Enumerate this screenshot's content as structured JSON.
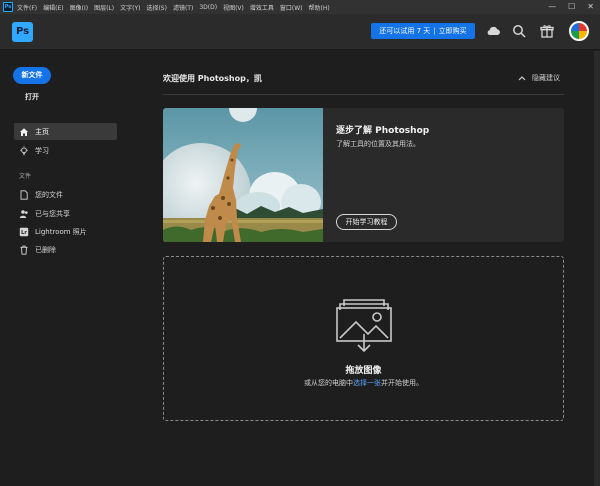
{
  "menubar": {
    "app_badge": "Ps",
    "items": [
      "文件(F)",
      "编辑(E)",
      "图像(I)",
      "图层(L)",
      "文字(Y)",
      "选择(S)",
      "滤镜(T)",
      "3D(D)",
      "视图(V)",
      "增效工具",
      "窗口(W)",
      "帮助(H)"
    ],
    "window_controls": {
      "minimize": "—",
      "maximize": "☐",
      "close": "✕"
    }
  },
  "toolbar": {
    "logo_text": "Ps",
    "trial_text": "还可以试用 7 天",
    "buy_text": "立即购买",
    "icons": [
      "cloud-icon",
      "search-icon",
      "gift-icon",
      "avatar"
    ]
  },
  "sidebar": {
    "new_file_label": "新文件",
    "open_label": "打开",
    "nav": [
      {
        "label": "主页",
        "icon": "home-icon",
        "active": true
      },
      {
        "label": "学习",
        "icon": "lightbulb-icon",
        "active": false
      }
    ],
    "files_section_label": "文件",
    "file_nav": [
      {
        "label": "您的文件",
        "icon": "document-icon"
      },
      {
        "label": "已与您共享",
        "icon": "shared-users-icon"
      },
      {
        "label": "Lightroom 照片",
        "icon": "lightroom-icon"
      },
      {
        "label": "已删除",
        "icon": "trash-icon"
      }
    ]
  },
  "main": {
    "welcome": "欢迎使用 Photoshop，凯",
    "hide_tips_label": "隐藏建议",
    "card": {
      "title": "逐步了解 Photoshop",
      "description": "了解工具的位置及其用法。",
      "button_label": "开始学习教程"
    },
    "dropzone": {
      "title": "拖放图像",
      "sub_before": "或从您的电脑中",
      "sub_link": "选择一张",
      "sub_after": "并开始使用。"
    }
  },
  "colors": {
    "accent": "#1473e6",
    "ps_brand": "#31a8ff",
    "link": "#5aa2ff"
  }
}
